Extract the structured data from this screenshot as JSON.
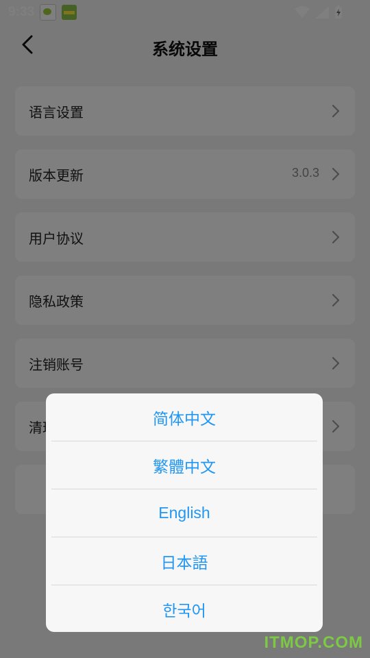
{
  "status_bar": {
    "time": "9:33",
    "app_icons": [
      "yc-app-icon",
      "green-app-icon"
    ],
    "system_icons": [
      "wifi-icon",
      "cell-signal-icon",
      "battery-charging-icon"
    ]
  },
  "header": {
    "title": "系统设置",
    "back_icon": "chevron-left-icon"
  },
  "settings": {
    "items": [
      {
        "label": "语言设置",
        "value": ""
      },
      {
        "label": "版本更新",
        "value": "3.0.3"
      },
      {
        "label": "用户协议",
        "value": ""
      },
      {
        "label": "隐私政策",
        "value": ""
      },
      {
        "label": "注销账号",
        "value": ""
      },
      {
        "label": "清理缓存",
        "value": ""
      }
    ]
  },
  "language_dialog": {
    "options": [
      "简体中文",
      "繁體中文",
      "English",
      "日本語",
      "한국어"
    ],
    "accent_color": "#2196f3"
  },
  "watermark": "ITMOP.COM"
}
